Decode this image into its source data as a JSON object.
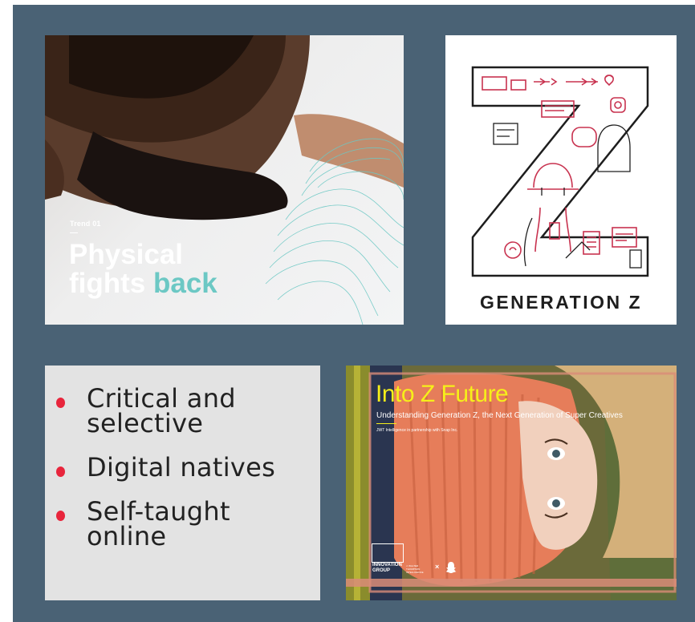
{
  "panel1": {
    "trend_label": "Trend 01",
    "headline_line1": "Physical",
    "headline_line2_word1": "fights ",
    "headline_line2_word2": "back"
  },
  "panel2": {
    "title": "GENERATION Z"
  },
  "panel3": {
    "bullets": [
      {
        "line1": "Critical and",
        "line2": "selective"
      },
      {
        "line1": "Digital natives",
        "line2": ""
      },
      {
        "line1": "Self-taught",
        "line2": "online"
      }
    ]
  },
  "panel4": {
    "title": "Into Z Future",
    "subtitle": "Understanding Generation Z, the Next Generation of Super Creatives",
    "partner": "JWT Intelligence in partnership with Snap Inc.",
    "logo_line1": "INNOVATION",
    "logo_line2": "GROUP",
    "jwt_tag": "J. WALTER THOMPSON INTELLIGENCE",
    "x_mark": "×"
  },
  "colors": {
    "board": "#4a6275",
    "accent_teal": "#6cc8c4",
    "bullet_red": "#e8253c",
    "title_yellow": "#f6ef1a",
    "z_outline_red": "#c8324f"
  }
}
